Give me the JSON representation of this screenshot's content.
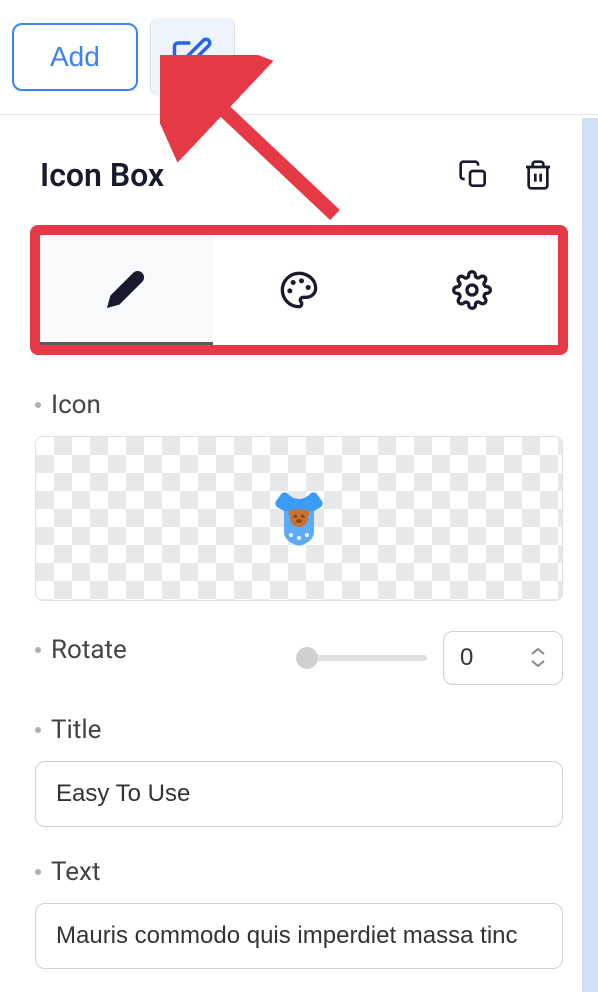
{
  "toolbar": {
    "add_label": "Add"
  },
  "panel": {
    "title": "Icon Box"
  },
  "fields": {
    "icon": {
      "label": "Icon",
      "preview_emoji": "👕"
    },
    "rotate": {
      "label": "Rotate",
      "value": "0"
    },
    "title": {
      "label": "Title",
      "value": "Easy To Use"
    },
    "text": {
      "label": "Text",
      "value": "Mauris commodo quis imperdiet massa tinc"
    }
  }
}
